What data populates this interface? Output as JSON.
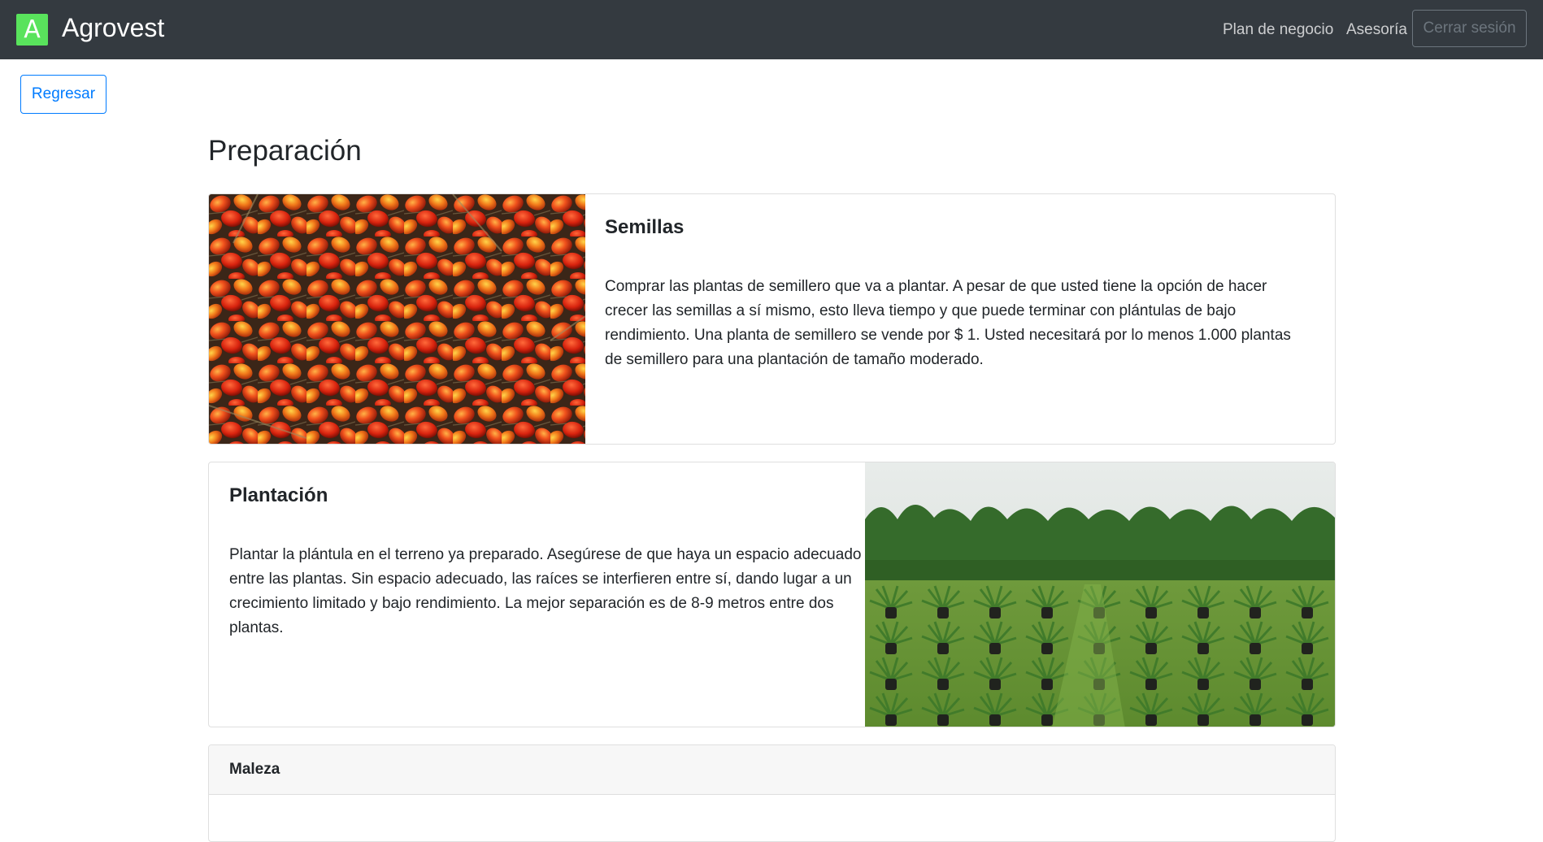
{
  "navbar": {
    "logo_letter": "A",
    "brand": "Agrovest",
    "links": [
      "Plan de negocio",
      "Asesoría"
    ],
    "logout_label": "Cerrar sesión"
  },
  "back_label": "Regresar",
  "page_title": "Preparación",
  "cards": [
    {
      "title": "Semillas",
      "text": "Comprar las plantas de semillero que va a plantar. A pesar de que usted tiene la opción de hacer crecer las semillas a sí mismo, esto lleva tiempo y que puede terminar con plántulas de bajo rendimiento. Una planta de semillero se vende por $ 1. Usted necesitará por lo menos 1.000 plantas de semillero para una plantación de tamaño moderado.",
      "image": "palm-fruits-photo"
    },
    {
      "title": "Plantación",
      "text": "Plantar la plántula en el terreno ya preparado. Asegúrese de que haya un espacio adecuado entre las plantas. Sin espacio adecuado, las raíces se interfieren entre sí, dando lugar a un crecimiento limitado y bajo rendimiento. La mejor separación es de 8-9 metros entre dos plantas.",
      "image": "palm-plantation-photo"
    },
    {
      "header": "Maleza"
    }
  ],
  "colors": {
    "navbar_bg": "#343a40",
    "logo_bg": "#59e35c",
    "primary": "#007bff",
    "muted": "#6c757d"
  }
}
